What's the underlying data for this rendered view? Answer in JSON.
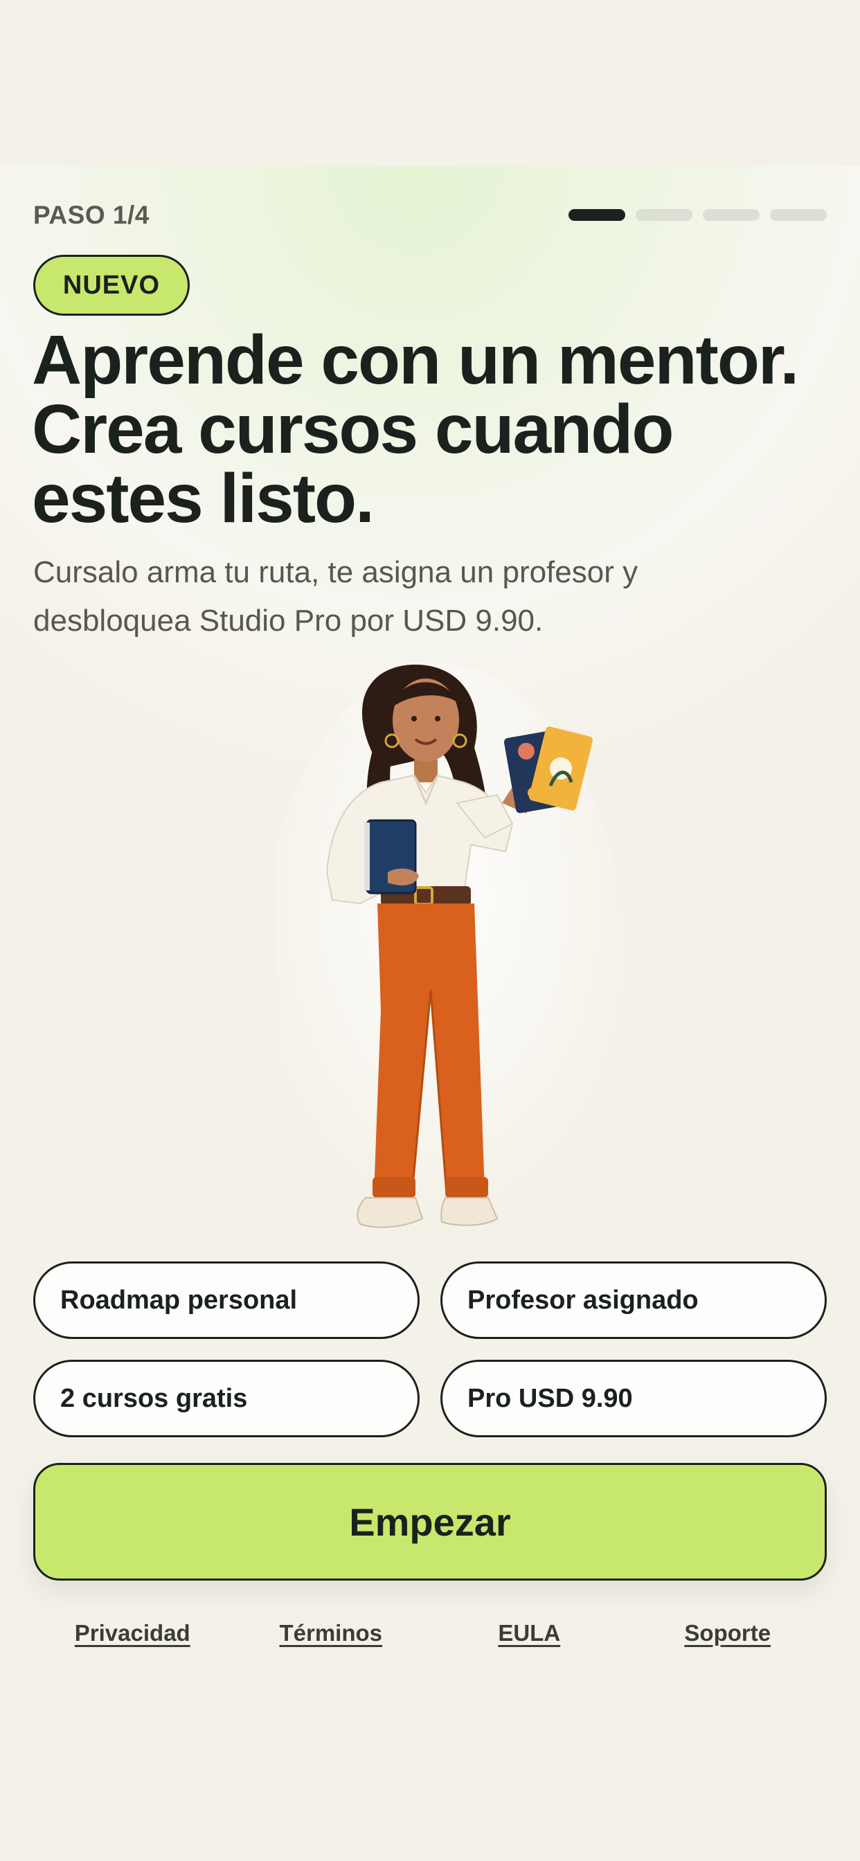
{
  "header": {
    "step_label": "PASO 1/4",
    "progress": {
      "current_step": 1,
      "total_steps": 4
    }
  },
  "badge": {
    "label": "NUEVO"
  },
  "hero": {
    "headline_lines": [
      "Aprende con un mentor.",
      "Crea cursos cuando",
      "estes listo."
    ],
    "subtitle_lines": [
      "Cursalo arma tu ruta, te asigna un profesor y",
      "desbloquea Studio Pro por USD 9.90."
    ],
    "illustration": "woman-with-notebook-and-cards-illustration"
  },
  "features": [
    {
      "label": "Roadmap personal"
    },
    {
      "label": "Profesor asignado"
    },
    {
      "label": "2 cursos gratis"
    },
    {
      "label": "Pro USD 9.90"
    }
  ],
  "cta": {
    "label": "Empezar"
  },
  "footer": {
    "links": [
      {
        "label": "Privacidad"
      },
      {
        "label": "Términos"
      },
      {
        "label": "EULA"
      },
      {
        "label": "Soporte"
      }
    ]
  },
  "colors": {
    "accent": "#c7e86c",
    "ink": "#1b211d",
    "background": "#f4f1e8",
    "pants": "#d9601d"
  }
}
